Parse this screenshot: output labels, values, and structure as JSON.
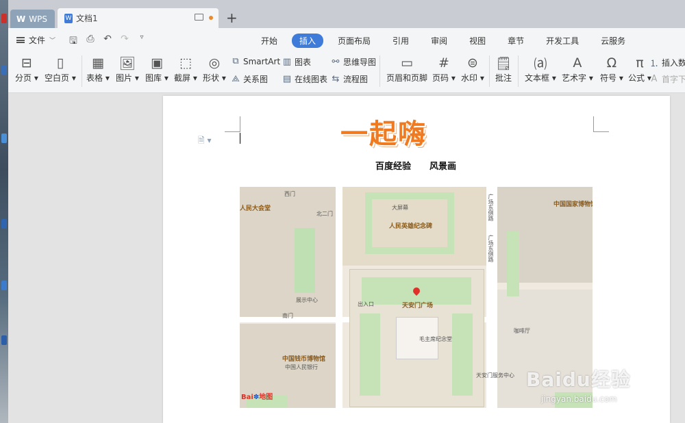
{
  "tabs": {
    "app": "WPS",
    "document": "文档1",
    "new_tab": "+"
  },
  "menu": {
    "file": "文件",
    "tabs": [
      "开始",
      "插入",
      "页面布局",
      "引用",
      "审阅",
      "视图",
      "章节",
      "开发工具",
      "云服务"
    ],
    "active_index": 1
  },
  "ribbon": {
    "page_break": "分页",
    "blank_page": "空白页",
    "table": "表格",
    "picture": "图片",
    "gallery": "图库",
    "screenshot": "截屏",
    "shapes": "形状",
    "smartart": "SmartArt",
    "chart": "图表",
    "mindmap": "思维导图",
    "relation": "关系图",
    "online_chart": "在线图表",
    "flowchart": "流程图",
    "header_footer": "页眉和页脚",
    "page_number": "页码",
    "watermark": "水印",
    "comment": "批注",
    "textbox": "文本框",
    "wordart": "艺术字",
    "symbol": "符号",
    "formula": "公式",
    "insert_number": "插入数",
    "first_letter": "首字下"
  },
  "document": {
    "title": "一起嗨",
    "subtitle_left": "百度经验",
    "subtitle_right": "风景画"
  },
  "map": {
    "labels": {
      "great_hall": "人民大会堂",
      "monument": "人民英雄纪念碑",
      "national_museum": "中国国家博物馆",
      "square": "天安门广场",
      "mausoleum": "毛主席纪念堂",
      "money_museum": "中国钱币博物馆",
      "east_road": "广场东侧路",
      "east_road2": "广场东侧路",
      "big_tent": "大屏幕",
      "exhibition": "展示中心",
      "west_gate": "西门",
      "north_gate": "北二门",
      "entry": "出入口",
      "south_gate": "南门",
      "bank": "中国人民银行",
      "service_center": "天安门服务中心",
      "coffee": "咖啡厅"
    },
    "logo_text": "Bai",
    "logo_text2": "地图"
  },
  "overlay": {
    "watermark": "Baidu经验",
    "watermark_url": "jingyan.baidu.com"
  }
}
